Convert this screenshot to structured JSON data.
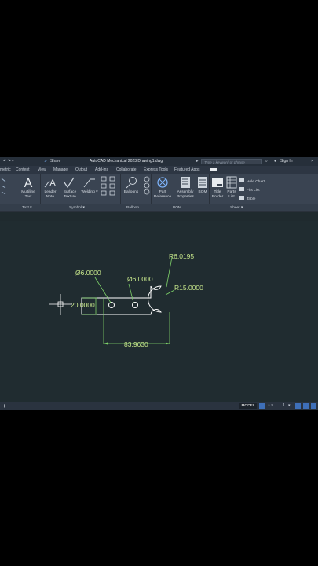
{
  "titlebar": {
    "share": "Share",
    "title": "AutoCAD Mechanical 2023   Drawing1.dwg",
    "search_placeholder": "Type a keyword or phrase",
    "sign_in": "Sign In"
  },
  "tabs": [
    "metric",
    "Content",
    "View",
    "Manage",
    "Output",
    "Add-ins",
    "Collaborate",
    "Express Tools",
    "Featured Apps"
  ],
  "ribbon": {
    "tools": {
      "multiline": "Multiline",
      "multiline2": "Text",
      "leader": "Leader",
      "leader2": "Note",
      "surface": "Surface",
      "surface2": "Texture",
      "welding": "Welding",
      "balloons": "Balloons",
      "part": "Part",
      "part2": "Reference",
      "assembly": "Assembly",
      "assembly2": "Properties",
      "bom": "BOM",
      "title": "Title",
      "title2": "Border",
      "parts": "Parts",
      "parts2": "List",
      "hole_chart": "Hole Chart",
      "fits_list": "Fits List",
      "table": "Table"
    },
    "panels": {
      "text": "Text ▾",
      "symbol": "Symbol ▾",
      "balloon": "Balloon",
      "bom": "BOM",
      "sheet": "Sheet ▾"
    }
  },
  "drawing": {
    "dim_hole_left": "Ø6.0000",
    "dim_hole_right": "Ø6.0000",
    "dim_r6": "R6.0195",
    "dim_r15": "R15.0000",
    "dim_height": "20.0000",
    "dim_length": "83.9630",
    "colors": {
      "geometry": "#ffffff",
      "dimension": "#c8e88c",
      "dim_line": "#7fd46a"
    }
  },
  "statusbar": {
    "plus": "+",
    "model": "MODEL",
    "scale": "1"
  }
}
